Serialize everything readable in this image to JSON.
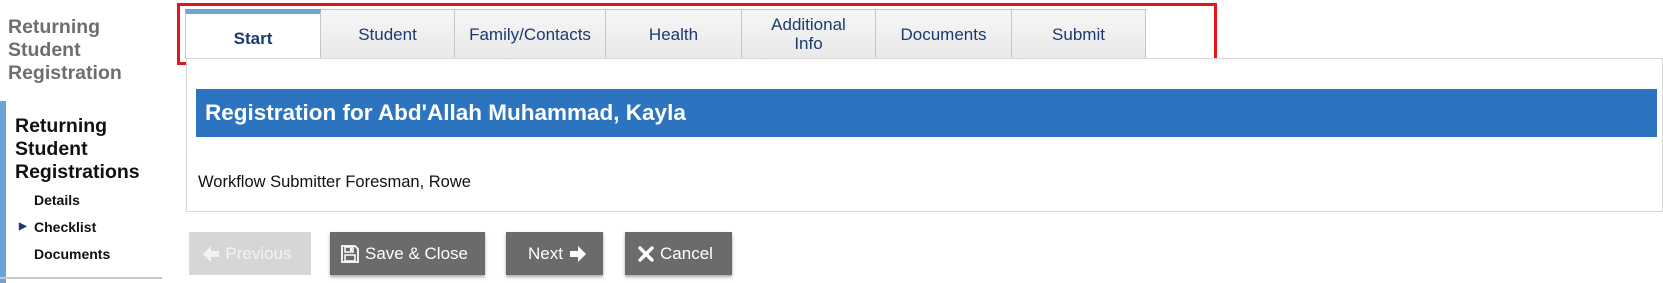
{
  "sidebar": {
    "app_title": "Returning Student Registration",
    "section_title": "Returning Student Registrations",
    "items": [
      {
        "label": "Details",
        "selected": false
      },
      {
        "label": "Checklist",
        "selected": true
      },
      {
        "label": "Documents",
        "selected": false
      }
    ]
  },
  "tabs": [
    {
      "label": "Start",
      "active": true
    },
    {
      "label": "Student",
      "active": false
    },
    {
      "label": "Family/Contacts",
      "active": false
    },
    {
      "label": "Health",
      "active": false
    },
    {
      "label": "Additional Info",
      "active": false
    },
    {
      "label": "Documents",
      "active": false
    },
    {
      "label": "Submit",
      "active": false
    }
  ],
  "main": {
    "banner_title": "Registration for Abd'Allah Muhammad, Kayla",
    "submitter_text": "Workflow Submitter Foresman, Rowe"
  },
  "buttons": {
    "previous": {
      "label": "Previous",
      "icon": "arrow-left-icon",
      "enabled": false
    },
    "save_close": {
      "label": "Save & Close",
      "icon": "floppy-disk-icon",
      "enabled": true
    },
    "next": {
      "label": "Next",
      "icon": "arrow-right-icon",
      "enabled": true
    },
    "cancel": {
      "label": "Cancel",
      "icon": "x-icon",
      "enabled": true
    }
  },
  "colors": {
    "banner": "#2c74bf",
    "active_tab_accent": "#6da4d8",
    "tab_text": "#1a3a70",
    "button": "#6b6b6b",
    "button_disabled": "#d6d6d6",
    "highlight_box": "#e8141c"
  }
}
